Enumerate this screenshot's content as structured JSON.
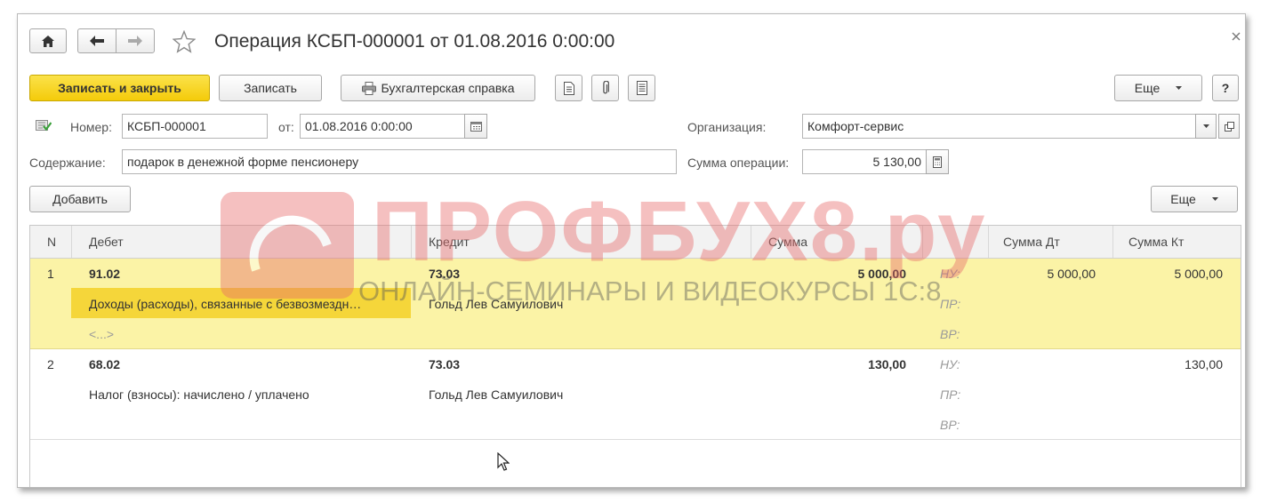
{
  "title": "Операция КСБП-000001 от 01.08.2016 0:00:00",
  "toolbar": {
    "save_close": "Записать и закрыть",
    "save": "Записать",
    "report": "Бухгалтерская справка",
    "more": "Еще",
    "help": "?"
  },
  "form": {
    "number_label": "Номер:",
    "number_value": "КСБП-000001",
    "date_label": "от:",
    "date_value": "01.08.2016  0:00:00",
    "org_label": "Организация:",
    "org_value": "Комфорт-сервис",
    "content_label": "Содержание:",
    "content_value": "подарок в денежной форме пенсионеру",
    "sum_label": "Сумма операции:",
    "sum_value": "5 130,00"
  },
  "table_toolbar": {
    "add": "Добавить",
    "more": "Еще"
  },
  "table": {
    "headers": {
      "n": "N",
      "debit": "Дебет",
      "credit": "Кредит",
      "sum": "Сумма",
      "sum_dt": "Сумма Дт",
      "sum_kt": "Сумма Кт"
    },
    "rows": [
      {
        "n": "1",
        "debit": "91.02",
        "debit_sub1": "Доходы (расходы), связанные с безвозмездн…",
        "debit_sub2": "<...>",
        "credit": "73.03",
        "credit_sub1": "Гольд Лев Самуилович",
        "sum": "5 000,00",
        "nu": "НУ:",
        "pr": "ПР:",
        "vr": "ВР:",
        "sum_dt": "5 000,00",
        "sum_kt": "5 000,00"
      },
      {
        "n": "2",
        "debit": "68.02",
        "debit_sub1": "Налог (взносы): начислено / уплачено",
        "debit_sub2": "",
        "credit": "73.03",
        "credit_sub1": "Гольд Лев Самуилович",
        "sum": "130,00",
        "nu": "НУ:",
        "pr": "ПР:",
        "vr": "ВР:",
        "sum_dt": "",
        "sum_kt": "130,00"
      }
    ]
  },
  "watermark": {
    "title": "ПРОФБУХ8.ру",
    "subtitle": "ОНЛАЙН-СЕМИНАРЫ И ВИДЕОКУРСЫ 1С:8"
  },
  "colors": {
    "accent": "#f4cb0a",
    "selected_row": "#fbf3a6",
    "watermark": "#e86a6a"
  }
}
